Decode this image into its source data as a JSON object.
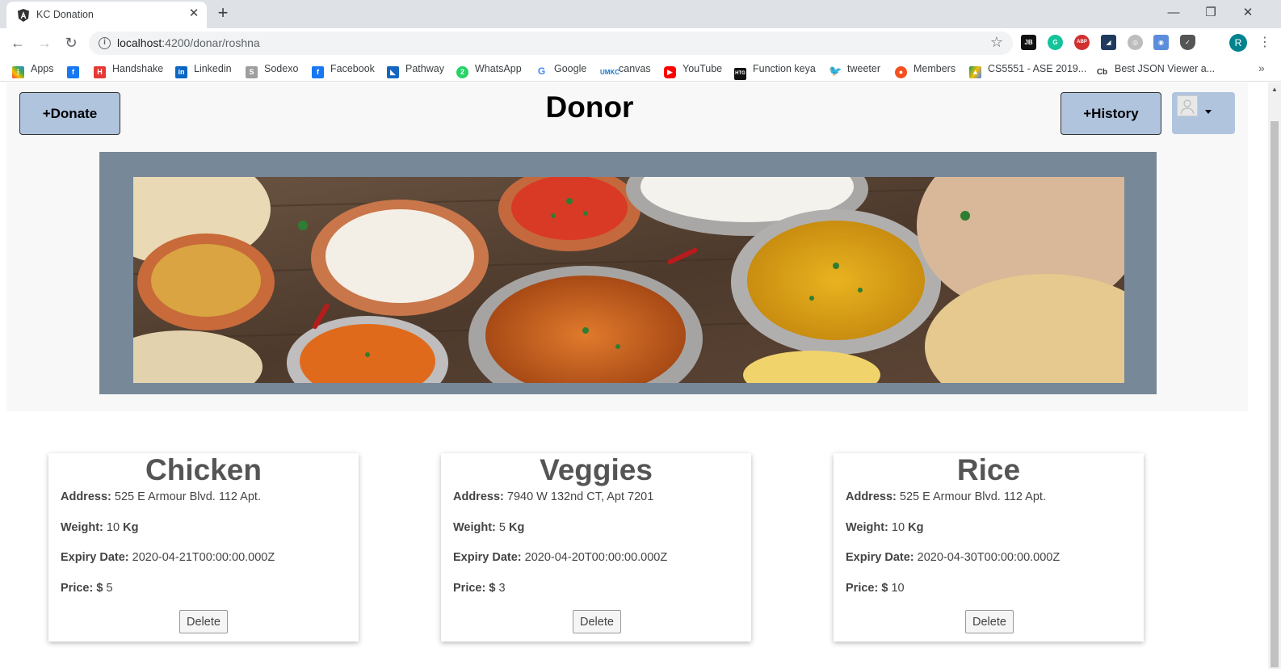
{
  "browser": {
    "tab_title": "KC Donation",
    "tab_close": "✕",
    "new_tab": "+",
    "window_controls": {
      "minimize": "—",
      "restore": "❐",
      "close": "✕"
    },
    "nav": {
      "back": "←",
      "forward": "→",
      "reload": "↻"
    },
    "url_host": "localhost",
    "url_rest": ":4200/donar/roshna",
    "profile_initial": "R",
    "bookmarks": [
      {
        "label": "Apps",
        "icon": "apps-grid-icon",
        "color": "#ea4335"
      },
      {
        "label": "",
        "icon": "facebook-icon",
        "color": "#1877f2"
      },
      {
        "label": "Handshake",
        "icon": "handshake-icon",
        "color": "#e53935"
      },
      {
        "label": "Linkedin",
        "icon": "linkedin-icon",
        "color": "#0a66c2"
      },
      {
        "label": "Sodexo",
        "icon": "sodexo-icon",
        "color": "#8a8a8a"
      },
      {
        "label": "Facebook",
        "icon": "facebook-icon",
        "color": "#1877f2"
      },
      {
        "label": "Pathway",
        "icon": "pathway-icon",
        "color": "#1565c0"
      },
      {
        "label": "WhatsApp",
        "icon": "whatsapp-icon",
        "color": "#25d366"
      },
      {
        "label": "Google",
        "icon": "google-icon",
        "color": "#4285f4"
      },
      {
        "label": "canvas",
        "icon": "canvas-icon",
        "color": "#1976d2"
      },
      {
        "label": "YouTube",
        "icon": "youtube-icon",
        "color": "#ff0000"
      },
      {
        "label": "Function keya",
        "icon": "htg-icon",
        "color": "#111111"
      },
      {
        "label": "tweeter",
        "icon": "twitter-icon",
        "color": "#1da1f2"
      },
      {
        "label": "Members",
        "icon": "members-icon",
        "color": "#f4511e"
      },
      {
        "label": "CS5551 - ASE 2019...",
        "icon": "google-drive-icon",
        "color": "#fbbc04"
      },
      {
        "label": "Best JSON Viewer a...",
        "icon": "cb-icon",
        "color": "#333333"
      }
    ],
    "bookmarks_more": "»"
  },
  "header": {
    "donate_label": "+Donate",
    "title": "Donor",
    "history_label": "+History"
  },
  "donations": [
    {
      "title": "Chicken",
      "address_label": "Address:",
      "address": "525 E Armour Blvd. 112 Apt.",
      "weight_label": "Weight:",
      "weight": "10",
      "weight_unit": "Kg",
      "expiry_label": "Expiry Date:",
      "expiry": "2020-04-21T00:00:00.000Z",
      "price_label": "Price:",
      "price_symbol": "$",
      "price": "5",
      "delete_label": "Delete"
    },
    {
      "title": "Veggies",
      "address_label": "Address:",
      "address": "7940 W 132nd CT, Apt 7201",
      "weight_label": "Weight:",
      "weight": "5",
      "weight_unit": "Kg",
      "expiry_label": "Expiry Date:",
      "expiry": "2020-04-20T00:00:00.000Z",
      "price_label": "Price:",
      "price_symbol": "$",
      "price": "3",
      "delete_label": "Delete"
    },
    {
      "title": "Rice",
      "address_label": "Address:",
      "address": "525 E Armour Blvd. 112 Apt.",
      "weight_label": "Weight:",
      "weight": "10",
      "weight_unit": "Kg",
      "expiry_label": "Expiry Date:",
      "expiry": "2020-04-30T00:00:00.000Z",
      "price_label": "Price:",
      "price_symbol": "$",
      "price": "10",
      "delete_label": "Delete"
    }
  ],
  "colors": {
    "button_bg": "#b0c4de",
    "banner_frame": "#778899",
    "card_title": "#555555"
  }
}
